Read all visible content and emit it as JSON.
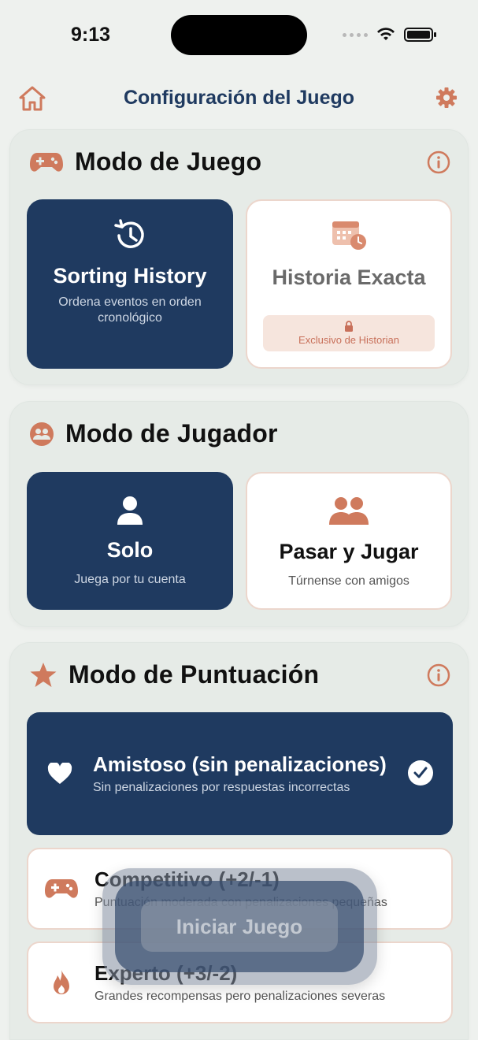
{
  "status_bar": {
    "time": "9:13"
  },
  "nav": {
    "title": "Configuración del Juego"
  },
  "colors": {
    "navy": "#1f3a60",
    "accent": "#cf7a5d",
    "background": "#eef1ee"
  },
  "game_mode": {
    "title": "Modo de Juego",
    "options": [
      {
        "title": "Sorting History",
        "subtitle": "Ordena eventos en orden cronológico",
        "selected": true,
        "icon": "history-icon"
      },
      {
        "title": "Historia Exacta",
        "badge": "Exclusivo de Historian",
        "selected": false,
        "locked": true,
        "icon": "calendar-clock-icon"
      }
    ]
  },
  "player_mode": {
    "title": "Modo de Jugador",
    "options": [
      {
        "title": "Solo",
        "subtitle": "Juega por tu cuenta",
        "selected": true,
        "icon": "person-icon"
      },
      {
        "title": "Pasar y Jugar",
        "subtitle": "Túrnense con amigos",
        "selected": false,
        "icon": "two-people-icon"
      }
    ]
  },
  "score_mode": {
    "title": "Modo de Puntuación",
    "options": [
      {
        "title": "Amistoso (sin penalizaciones)",
        "subtitle": "Sin penalizaciones por respuestas incorrectas",
        "selected": true,
        "icon": "heart-icon"
      },
      {
        "title": "Competitivo (+2/-1)",
        "subtitle": "Puntuación moderada con penalizaciones pequeñas",
        "selected": false,
        "icon": "gamepad-icon"
      },
      {
        "title": "Experto (+3/-2)",
        "subtitle": "Grandes recompensas pero penalizaciones severas",
        "selected": false,
        "icon": "flame-icon"
      }
    ]
  },
  "start_button": {
    "label": "Iniciar Juego"
  }
}
